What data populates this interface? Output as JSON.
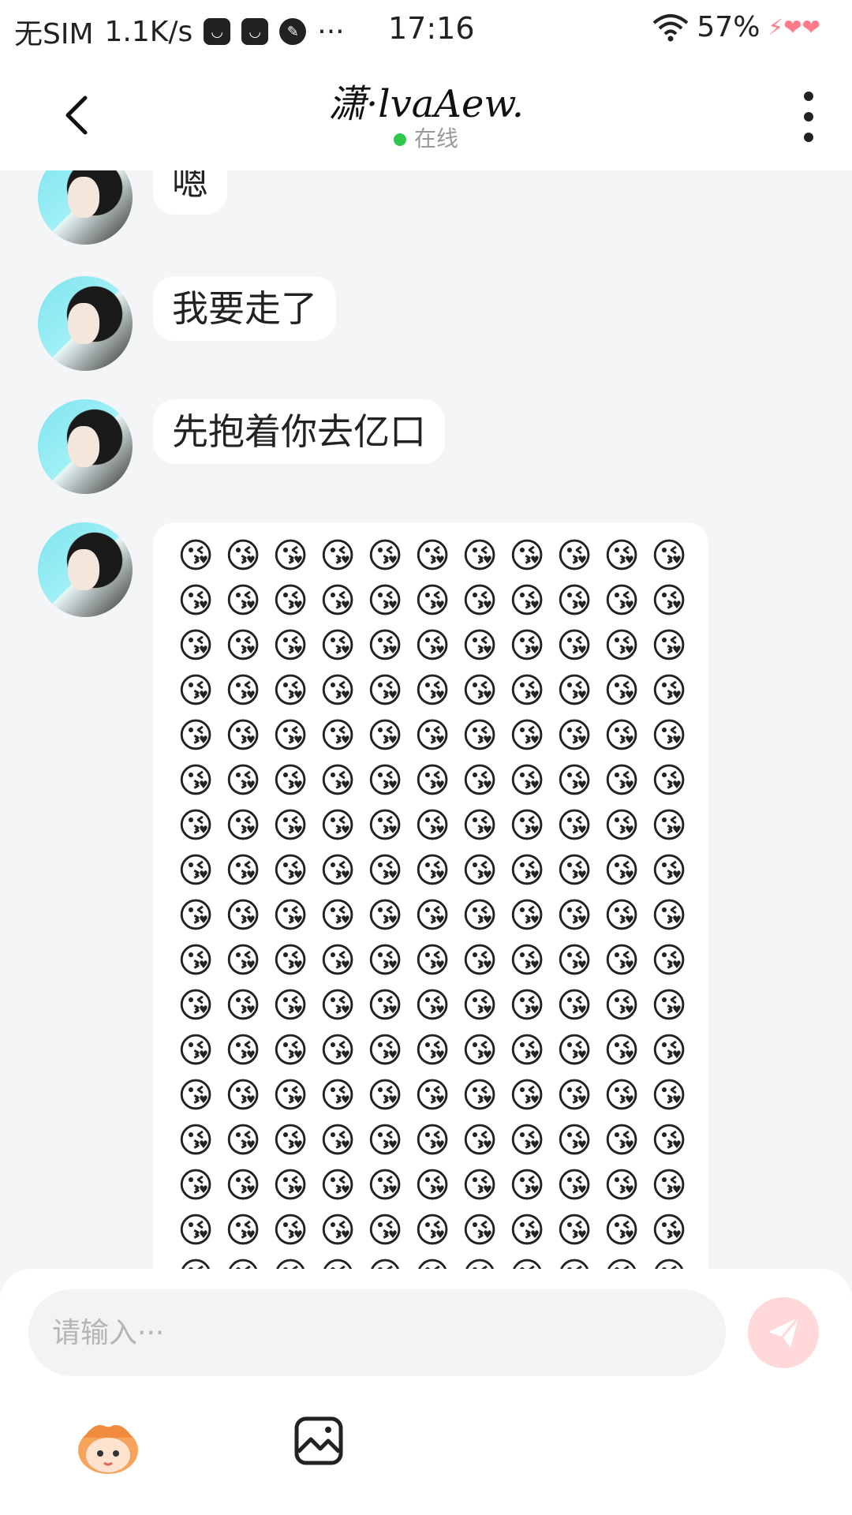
{
  "status_bar": {
    "carrier": "无SIM",
    "speed": "1.1K/s",
    "more": "···",
    "time": "17:16",
    "battery": "57%"
  },
  "header": {
    "title": "潇·lvaAew.",
    "status": "在线"
  },
  "messages": [
    {
      "text": "嗯"
    },
    {
      "text": "我要走了"
    },
    {
      "text": "先抱着你去亿口"
    }
  ],
  "emoji_message": {
    "emoji": "😘",
    "columns": 11,
    "visible_rows": 17
  },
  "input": {
    "placeholder": "请输入···"
  },
  "colors": {
    "online": "#2dc84d",
    "send_button": "#ffd9d9",
    "background": "#f4f5f7"
  }
}
